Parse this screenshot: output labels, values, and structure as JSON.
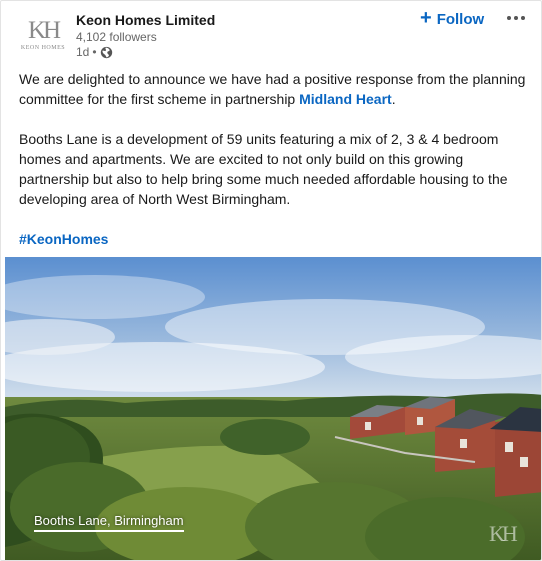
{
  "author": {
    "name": "Keon Homes Limited",
    "followers": "4,102 followers",
    "time": "1d",
    "separator": "•",
    "visibility_icon": "globe-icon"
  },
  "logo": {
    "mark": "KH",
    "subtitle": "KEON HOMES"
  },
  "actions": {
    "follow_icon": "plus-icon",
    "follow_label": "Follow",
    "more_icon": "more-horizontal-icon"
  },
  "post": {
    "p1_before": "We are delighted to announce we have had a positive response from the planning committee for the first scheme in partnership ",
    "p1_link": "Midland Heart",
    "p1_after": ".",
    "p2": "Booths Lane is a development of 59 units featuring a mix of 2, 3 & 4 bedroom homes and apartments. We are excited to not only build on this growing partnership but also to help bring some much needed affordable housing to the developing area of North West Birmingham.",
    "hashtag": "#KeonHomes"
  },
  "media": {
    "caption": "Booths Lane, Birmingham",
    "watermark": "KH"
  },
  "colors": {
    "link": "#0a66c2",
    "text": "#191919",
    "secondary": "#666666"
  }
}
